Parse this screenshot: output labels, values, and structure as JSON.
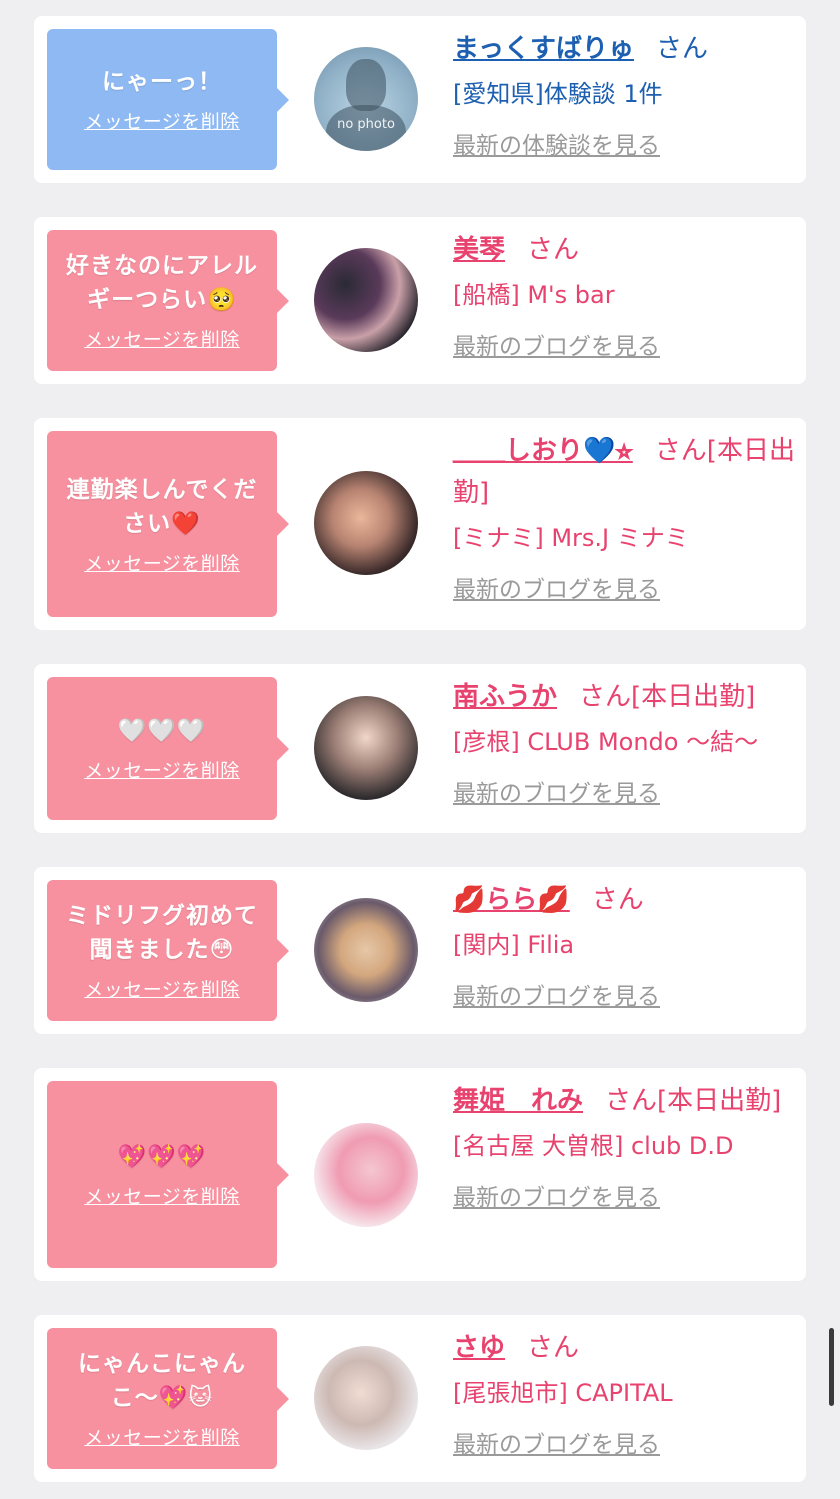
{
  "colors": {
    "background": "#efeff1",
    "pink_bubble": "#f7919f",
    "blue_bubble": "#8fb9f2",
    "pink_text": "#e8426e",
    "blue_text": "#1d5fb0",
    "link_gray": "#9a9a9a"
  },
  "items": [
    {
      "message": "にゃーっ！",
      "delete_label": "メッセージを削除",
      "avatar_label": "no photo",
      "name": "まっくすばりゅ",
      "honorific": "さん",
      "location": "[愛知県]体験談 1件",
      "link": "最新の体験談を見る",
      "theme": "blue"
    },
    {
      "message": "好きなのにアレルギーつらい🥺",
      "delete_label": "メッセージを削除",
      "name": "美琴",
      "honorific": "さん",
      "location": "[船橋] M's bar",
      "link": "最新のブログを見る",
      "theme": "pink"
    },
    {
      "message": "連勤楽しんでください❤️",
      "delete_label": "メッセージを削除",
      "name": "＿＿しおり💙⭐︎",
      "honorific": "さん[本日出勤]",
      "location": "[ミナミ] Mrs.J ミナミ",
      "link": "最新のブログを見る",
      "theme": "pink"
    },
    {
      "message": "🤍🤍🤍",
      "delete_label": "メッセージを削除",
      "name": "南ふうか",
      "honorific": "さん[本日出勤]",
      "location": "[彦根] CLUB Mondo 〜結〜",
      "link": "最新のブログを見る",
      "theme": "pink"
    },
    {
      "message": "ミドリフグ初めて聞きました😳",
      "delete_label": "メッセージを削除",
      "name": "💋らら💋",
      "honorific": "さん",
      "location": "[関内] Filia",
      "link": "最新のブログを見る",
      "theme": "pink"
    },
    {
      "message": "💖💖💖",
      "delete_label": "メッセージを削除",
      "name": "舞姫　れみ",
      "honorific": "さん[本日出勤]",
      "location": "[名古屋 大曽根] club D.D",
      "link": "最新のブログを見る",
      "theme": "pink"
    },
    {
      "message": "にゃんこにゃんこ〜💖🐱",
      "delete_label": "メッセージを削除",
      "name": "さゆ",
      "honorific": "さん",
      "location": "[尾張旭市] CAPITAL",
      "link": "最新のブログを見る",
      "theme": "pink"
    }
  ]
}
